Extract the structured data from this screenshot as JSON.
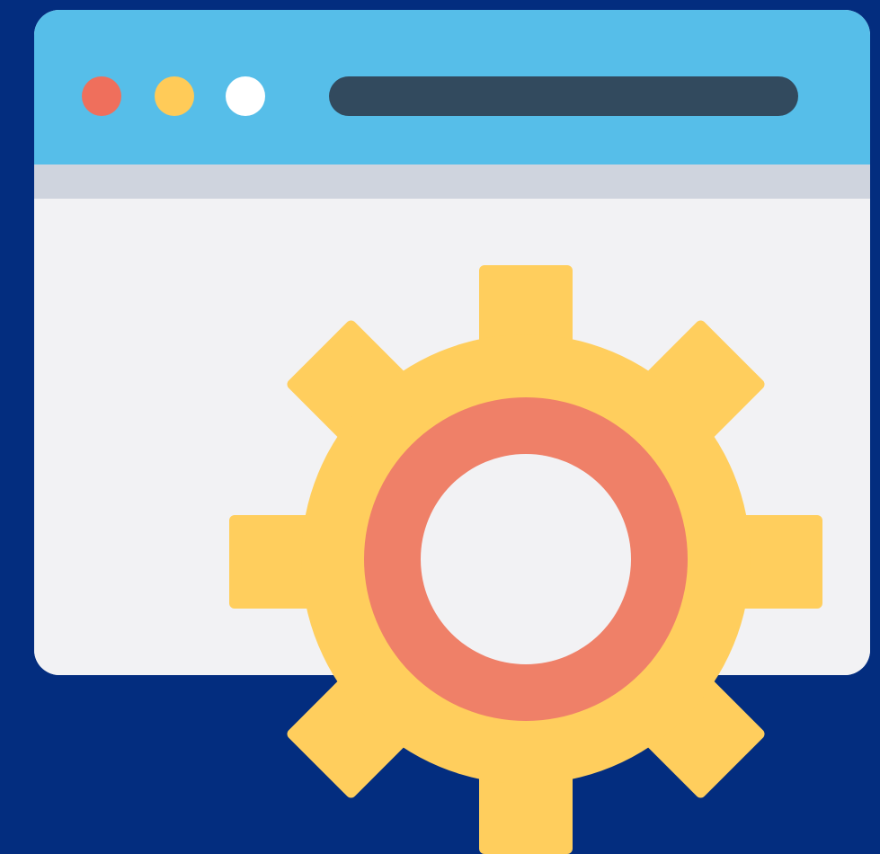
{
  "scene": {
    "kind": "browser-settings-illustration",
    "colors": {
      "background": "#032d7f",
      "window_frame": "#56bee9",
      "window_divider": "#cfd4de",
      "window_content": "#f2f2f4",
      "address_bar": "#324a5e",
      "dot_close": "#ef6f5c",
      "dot_minimize": "#ffcb58",
      "dot_maximize": "#ffffff",
      "gear_body": "#ffce5d",
      "gear_ring": "#ef8068",
      "gear_hole": "#f2f2f4"
    },
    "icons": {
      "browser": "browser-window-icon",
      "gear": "settings-gear-icon"
    }
  }
}
